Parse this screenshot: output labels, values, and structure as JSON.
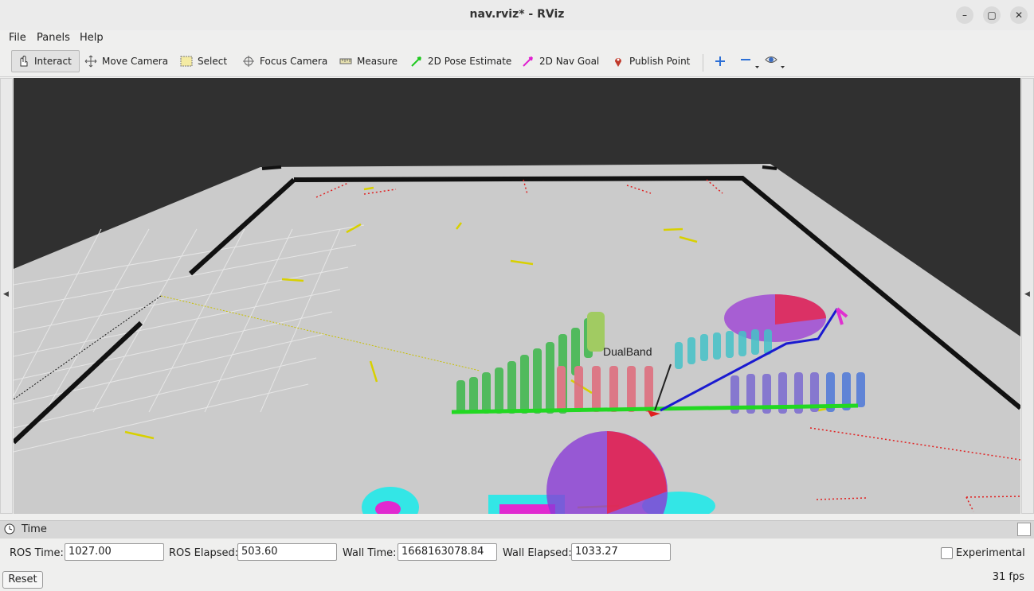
{
  "window": {
    "title": "nav.rviz* - RViz",
    "minimize": "–",
    "maximize": "▢",
    "close": "✕"
  },
  "menu": {
    "file": "File",
    "panels": "Panels",
    "help": "Help"
  },
  "toolbar": {
    "interact": "Interact",
    "move_camera": "Move Camera",
    "select": "Select",
    "focus_camera": "Focus Camera",
    "measure": "Measure",
    "pose_estimate": "2D Pose Estimate",
    "nav_goal": "2D Nav Goal",
    "publish_point": "Publish Point"
  },
  "viewport": {
    "label": "DualBand"
  },
  "time_panel": {
    "title": "Time",
    "ros_time_label": "ROS Time:",
    "ros_time": "1027.00",
    "ros_elapsed_label": "ROS Elapsed:",
    "ros_elapsed": "503.60",
    "wall_time_label": "Wall Time:",
    "wall_time": "1668163078.84",
    "wall_elapsed_label": "Wall Elapsed:",
    "wall_elapsed": "1033.27",
    "experimental_label": "Experimental",
    "experimental_checked": false
  },
  "footer": {
    "reset": "Reset",
    "fps": "31 fps"
  },
  "colors": {
    "viewport_bg": "#303030",
    "floor": "#c9c9c9",
    "wall": "#111111",
    "path": "#1a1ad0",
    "trajectory": "#22d822"
  }
}
